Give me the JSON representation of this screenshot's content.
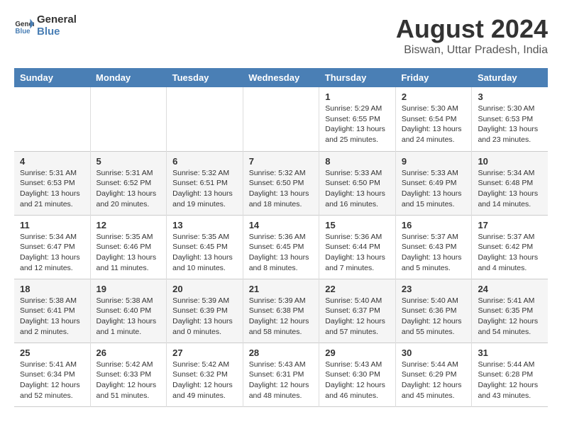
{
  "header": {
    "logo_line1": "General",
    "logo_line2": "Blue",
    "main_title": "August 2024",
    "subtitle": "Biswan, Uttar Pradesh, India"
  },
  "days_of_week": [
    "Sunday",
    "Monday",
    "Tuesday",
    "Wednesday",
    "Thursday",
    "Friday",
    "Saturday"
  ],
  "weeks": [
    {
      "days": [
        {
          "number": "",
          "info": ""
        },
        {
          "number": "",
          "info": ""
        },
        {
          "number": "",
          "info": ""
        },
        {
          "number": "",
          "info": ""
        },
        {
          "number": "1",
          "info": "Sunrise: 5:29 AM\nSunset: 6:55 PM\nDaylight: 13 hours\nand 25 minutes."
        },
        {
          "number": "2",
          "info": "Sunrise: 5:30 AM\nSunset: 6:54 PM\nDaylight: 13 hours\nand 24 minutes."
        },
        {
          "number": "3",
          "info": "Sunrise: 5:30 AM\nSunset: 6:53 PM\nDaylight: 13 hours\nand 23 minutes."
        }
      ]
    },
    {
      "days": [
        {
          "number": "4",
          "info": "Sunrise: 5:31 AM\nSunset: 6:53 PM\nDaylight: 13 hours\nand 21 minutes."
        },
        {
          "number": "5",
          "info": "Sunrise: 5:31 AM\nSunset: 6:52 PM\nDaylight: 13 hours\nand 20 minutes."
        },
        {
          "number": "6",
          "info": "Sunrise: 5:32 AM\nSunset: 6:51 PM\nDaylight: 13 hours\nand 19 minutes."
        },
        {
          "number": "7",
          "info": "Sunrise: 5:32 AM\nSunset: 6:50 PM\nDaylight: 13 hours\nand 18 minutes."
        },
        {
          "number": "8",
          "info": "Sunrise: 5:33 AM\nSunset: 6:50 PM\nDaylight: 13 hours\nand 16 minutes."
        },
        {
          "number": "9",
          "info": "Sunrise: 5:33 AM\nSunset: 6:49 PM\nDaylight: 13 hours\nand 15 minutes."
        },
        {
          "number": "10",
          "info": "Sunrise: 5:34 AM\nSunset: 6:48 PM\nDaylight: 13 hours\nand 14 minutes."
        }
      ]
    },
    {
      "days": [
        {
          "number": "11",
          "info": "Sunrise: 5:34 AM\nSunset: 6:47 PM\nDaylight: 13 hours\nand 12 minutes."
        },
        {
          "number": "12",
          "info": "Sunrise: 5:35 AM\nSunset: 6:46 PM\nDaylight: 13 hours\nand 11 minutes."
        },
        {
          "number": "13",
          "info": "Sunrise: 5:35 AM\nSunset: 6:45 PM\nDaylight: 13 hours\nand 10 minutes."
        },
        {
          "number": "14",
          "info": "Sunrise: 5:36 AM\nSunset: 6:45 PM\nDaylight: 13 hours\nand 8 minutes."
        },
        {
          "number": "15",
          "info": "Sunrise: 5:36 AM\nSunset: 6:44 PM\nDaylight: 13 hours\nand 7 minutes."
        },
        {
          "number": "16",
          "info": "Sunrise: 5:37 AM\nSunset: 6:43 PM\nDaylight: 13 hours\nand 5 minutes."
        },
        {
          "number": "17",
          "info": "Sunrise: 5:37 AM\nSunset: 6:42 PM\nDaylight: 13 hours\nand 4 minutes."
        }
      ]
    },
    {
      "days": [
        {
          "number": "18",
          "info": "Sunrise: 5:38 AM\nSunset: 6:41 PM\nDaylight: 13 hours\nand 2 minutes."
        },
        {
          "number": "19",
          "info": "Sunrise: 5:38 AM\nSunset: 6:40 PM\nDaylight: 13 hours\nand 1 minute."
        },
        {
          "number": "20",
          "info": "Sunrise: 5:39 AM\nSunset: 6:39 PM\nDaylight: 13 hours\nand 0 minutes."
        },
        {
          "number": "21",
          "info": "Sunrise: 5:39 AM\nSunset: 6:38 PM\nDaylight: 12 hours\nand 58 minutes."
        },
        {
          "number": "22",
          "info": "Sunrise: 5:40 AM\nSunset: 6:37 PM\nDaylight: 12 hours\nand 57 minutes."
        },
        {
          "number": "23",
          "info": "Sunrise: 5:40 AM\nSunset: 6:36 PM\nDaylight: 12 hours\nand 55 minutes."
        },
        {
          "number": "24",
          "info": "Sunrise: 5:41 AM\nSunset: 6:35 PM\nDaylight: 12 hours\nand 54 minutes."
        }
      ]
    },
    {
      "days": [
        {
          "number": "25",
          "info": "Sunrise: 5:41 AM\nSunset: 6:34 PM\nDaylight: 12 hours\nand 52 minutes."
        },
        {
          "number": "26",
          "info": "Sunrise: 5:42 AM\nSunset: 6:33 PM\nDaylight: 12 hours\nand 51 minutes."
        },
        {
          "number": "27",
          "info": "Sunrise: 5:42 AM\nSunset: 6:32 PM\nDaylight: 12 hours\nand 49 minutes."
        },
        {
          "number": "28",
          "info": "Sunrise: 5:43 AM\nSunset: 6:31 PM\nDaylight: 12 hours\nand 48 minutes."
        },
        {
          "number": "29",
          "info": "Sunrise: 5:43 AM\nSunset: 6:30 PM\nDaylight: 12 hours\nand 46 minutes."
        },
        {
          "number": "30",
          "info": "Sunrise: 5:44 AM\nSunset: 6:29 PM\nDaylight: 12 hours\nand 45 minutes."
        },
        {
          "number": "31",
          "info": "Sunrise: 5:44 AM\nSunset: 6:28 PM\nDaylight: 12 hours\nand 43 minutes."
        }
      ]
    }
  ]
}
